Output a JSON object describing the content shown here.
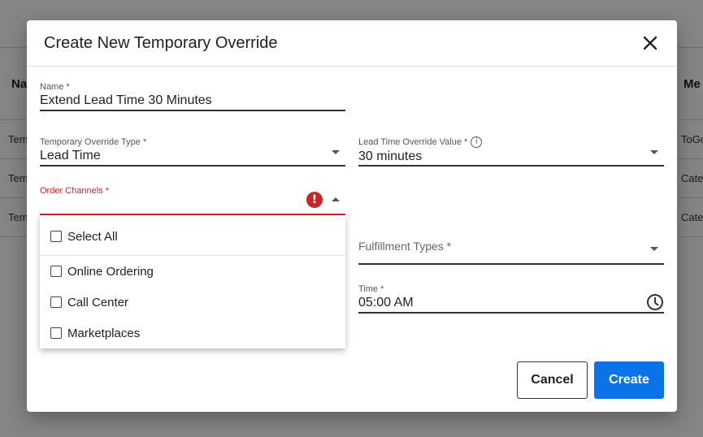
{
  "background": {
    "header_left": "Na",
    "header_right": "Me",
    "rows": [
      {
        "left": "Tem",
        "right": "ToGo"
      },
      {
        "left": "Tem",
        "right": "Cate"
      },
      {
        "left": "Tem",
        "right": "Cate"
      }
    ]
  },
  "dialog": {
    "title": "Create New Temporary Override",
    "name": {
      "label": "Name *",
      "value": "Extend Lead Time 30 Minutes"
    },
    "override_type": {
      "label": "Temporary Override Type *",
      "value": "Lead Time"
    },
    "lead_time_value": {
      "label": "Lead Time Override Value *",
      "value": "30 minutes"
    },
    "order_channels": {
      "label": "Order Channels *",
      "options": [
        {
          "label": "Select All",
          "checked": false
        },
        {
          "label": "Online Ordering",
          "checked": false
        },
        {
          "label": "Call Center",
          "checked": false
        },
        {
          "label": "Marketplaces",
          "checked": false
        }
      ]
    },
    "fulfillment_types": {
      "placeholder": "Fulfillment Types *"
    },
    "time": {
      "label": "Time *",
      "value": "05:00 AM"
    },
    "cancel_label": "Cancel",
    "create_label": "Create"
  },
  "colors": {
    "primary": "#0a73e8",
    "error": "#c62828",
    "overlay": "rgba(0,0,0,0.48)"
  },
  "icons": {
    "close": "close-icon",
    "error": "error-icon",
    "info": "info-icon",
    "clock": "clock-icon"
  }
}
